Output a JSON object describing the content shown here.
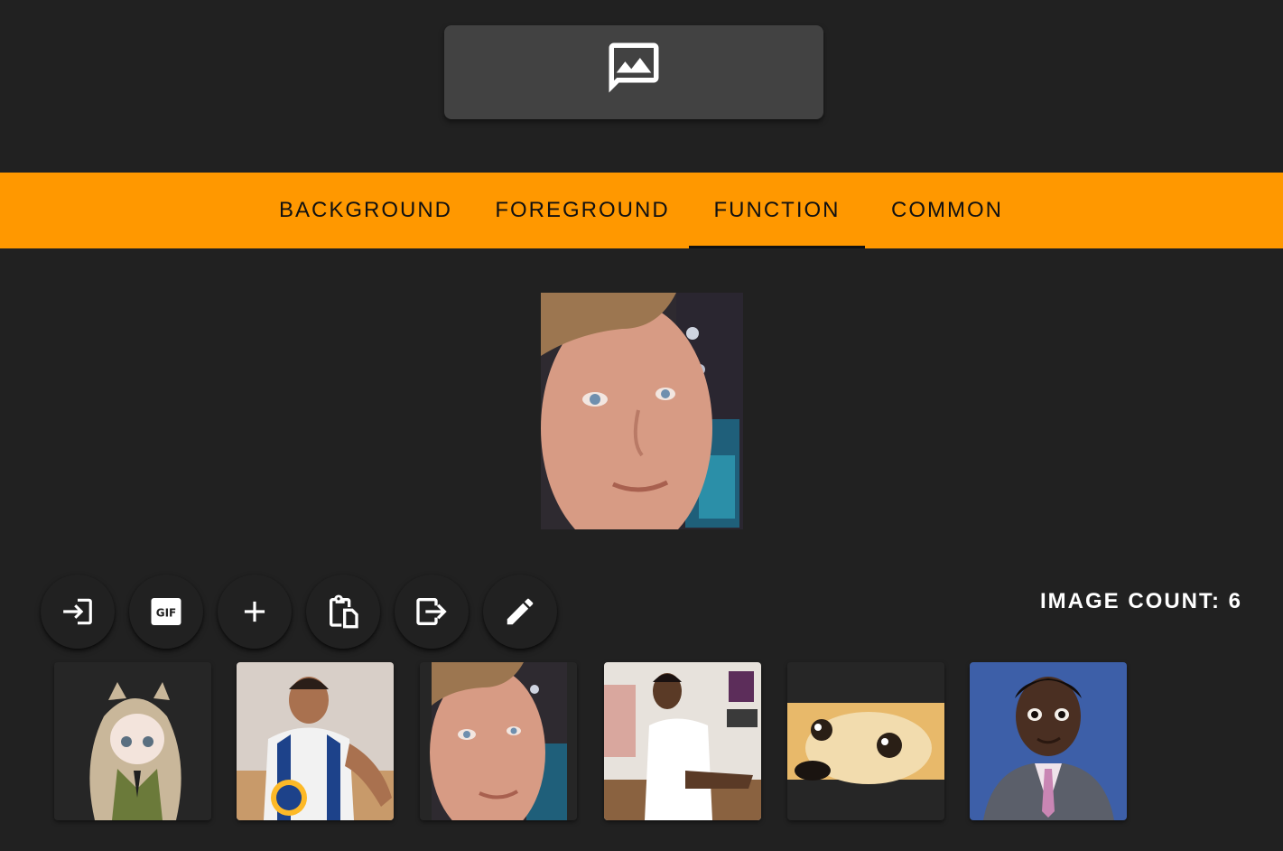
{
  "tabs": [
    {
      "label": "BACKGROUND",
      "active": false
    },
    {
      "label": "FOREGROUND",
      "active": false
    },
    {
      "label": "FUNCTION",
      "active": true
    },
    {
      "label": "COMMON",
      "active": false
    }
  ],
  "toolbar": {
    "buttons": [
      "import-icon",
      "gif-icon",
      "add-icon",
      "paste-icon",
      "export-icon",
      "edit-icon"
    ],
    "gif_text": "GIF"
  },
  "image_count": {
    "label": "IMAGE COUNT: 6",
    "value": 6
  },
  "thumbnails": [
    {
      "name": "anime-girl"
    },
    {
      "name": "basketball-player"
    },
    {
      "name": "blinking-man"
    },
    {
      "name": "confused-man"
    },
    {
      "name": "doge"
    },
    {
      "name": "surprised-man"
    }
  ],
  "colors": {
    "accent": "#ff9800",
    "background": "#212121",
    "surface": "#424242"
  }
}
